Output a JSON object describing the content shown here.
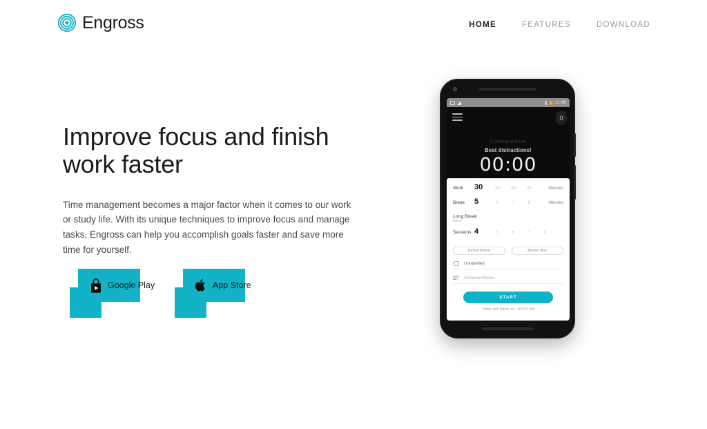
{
  "brand": {
    "name": "Engross",
    "logo_icon": "concentric-circles-icon",
    "color": "#13b2c6"
  },
  "nav": {
    "items": [
      {
        "label": "HOME",
        "active": true
      },
      {
        "label": "FEATURES",
        "active": false
      },
      {
        "label": "DOWNLOAD",
        "active": false
      }
    ]
  },
  "hero": {
    "title": "Improve focus and finish work faster",
    "paragraph": "Time management becomes a major factor when it comes to our work or study life. With its unique techniques to improve focus and manage tasks, Engross can help you accomplish goals faster and save more time for yourself."
  },
  "store_buttons": [
    {
      "label": "Google Play",
      "icon": "google-play-icon"
    },
    {
      "label": "App Store",
      "icon": "apple-icon"
    }
  ],
  "phone": {
    "status_bar": {
      "time": "11:46",
      "icons": [
        "screenshot-icon",
        "signal-icon",
        "bluetooth-icon",
        "battery-icon"
      ]
    },
    "app": {
      "menu_icon": "hamburger-icon",
      "badge": "0",
      "note_placeholder": "Comment/Note",
      "quote": "Beat distractions!",
      "timer": "00:00",
      "settings": [
        {
          "label": "Work",
          "value": "30",
          "options": [
            "35",
            "40",
            "45"
          ],
          "unit": "Minutes"
        },
        {
          "label": "Break",
          "value": "5",
          "options": [
            "6",
            "7",
            "8"
          ],
          "unit": "Minutes"
        }
      ],
      "long_break": {
        "label": "Long Break",
        "value": "Never"
      },
      "sessions": {
        "label": "Sessions",
        "value": "4",
        "options": [
          "5",
          "6",
          "7",
          "8"
        ]
      },
      "revise": [
        {
          "label": "Revise before"
        },
        {
          "label": "Revise after"
        }
      ],
      "tag_field": {
        "icon": "tag-icon",
        "text": "Unlabelled"
      },
      "note_field": {
        "icon": "notes-icon",
        "text": "Comment/Note..."
      },
      "start_label": "START",
      "finish_text": "Timer will finish at - 02:03 PM"
    }
  },
  "colors": {
    "accent": "#13b2c6",
    "text": "#1b1b1b",
    "muted": "#9a9a9a"
  }
}
